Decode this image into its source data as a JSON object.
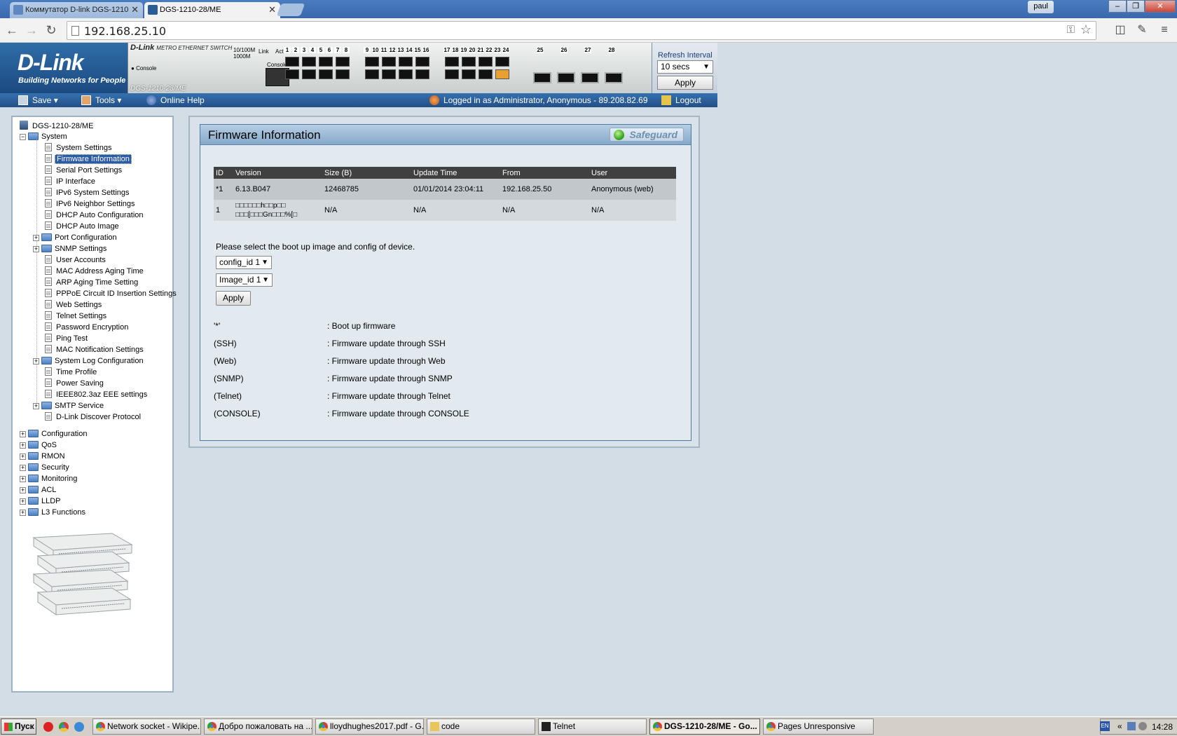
{
  "browser": {
    "tabs": [
      {
        "title": "Коммутатор D-link DGS-1210",
        "active": false
      },
      {
        "title": "DGS-1210-28/ME",
        "active": true
      }
    ],
    "url": "192.168.25.10",
    "user": "paul",
    "window_buttons": [
      "–",
      "❐",
      "✕"
    ]
  },
  "dlink": {
    "brand": "D-Link",
    "tagline": "Building Networks for People",
    "panel_brand": "D-Link",
    "panel_subtitle": "METRO ETHERNET SWITCH",
    "led_legend": [
      "10/100M",
      "1000M",
      "Link",
      "Act"
    ],
    "console_label": "Console",
    "console_led": "Console",
    "model": "DGS-1210-28/ME",
    "ports_copper": [
      "1",
      "2",
      "3",
      "4",
      "5",
      "6",
      "7",
      "8",
      "9",
      "10",
      "11",
      "12",
      "13",
      "14",
      "15",
      "16",
      "17",
      "18",
      "19",
      "20",
      "21",
      "22",
      "23",
      "24"
    ],
    "ports_sfp": [
      "25",
      "26",
      "27",
      "28"
    ],
    "active_port": "24",
    "refresh": {
      "label": "Refresh Interval",
      "value": "10 secs",
      "apply": "Apply"
    },
    "menu": {
      "save": "Save",
      "tools": "Tools",
      "help": "Online Help",
      "login_status": "Logged in as Administrator, Anonymous - 89.208.82.69",
      "logout": "Logout"
    }
  },
  "tree": {
    "root": "DGS-1210-28/ME",
    "system": "System",
    "system_items": [
      "System Settings",
      "Firmware Information",
      "Serial Port Settings",
      "IP Interface",
      "IPv6 System Settings",
      "IPv6 Neighbor Settings",
      "DHCP Auto Configuration",
      "DHCP Auto Image",
      "Port Configuration",
      "SNMP Settings",
      "User Accounts",
      "MAC Address Aging Time",
      "ARP Aging Time Setting",
      "PPPoE Circuit ID Insertion Settings",
      "Web Settings",
      "Telnet Settings",
      "Password Encryption",
      "Ping Test",
      "MAC Notification Settings",
      "System Log Configuration",
      "Time Profile",
      "Power Saving",
      "IEEE802.3az EEE settings",
      "SMTP Service",
      "D-Link Discover Protocol"
    ],
    "selected": "Firmware Information",
    "top_folders": [
      "Configuration",
      "QoS",
      "RMON",
      "Security",
      "Monitoring",
      "ACL",
      "LLDP",
      "L3 Functions"
    ]
  },
  "firmware": {
    "title": "Firmware Information",
    "safeguard": "Safeguard",
    "table": {
      "headers": [
        "ID",
        "Version",
        "Size (B)",
        "Update Time",
        "From",
        "User"
      ],
      "rows": [
        [
          "*1",
          "6.13.B047",
          "12468785",
          "01/01/2014 23:04:11",
          "192.168.25.50",
          "Anonymous (web)"
        ],
        [
          "1",
          "□□□□□□h□□p□□ □□□[□□□Gn□□□%[□",
          "N/A",
          "N/A",
          "N/A",
          "N/A"
        ]
      ]
    },
    "prompt": "Please select the boot up image and config of device.",
    "config_select": "config_id 1",
    "image_select": "Image_id 1",
    "apply": "Apply",
    "legend": [
      {
        "key": "'*'",
        "desc": ": Boot up firmware"
      },
      {
        "key": "(SSH)",
        "desc": ": Firmware update through SSH"
      },
      {
        "key": "(Web)",
        "desc": ": Firmware update through Web"
      },
      {
        "key": "(SNMP)",
        "desc": ": Firmware update through SNMP"
      },
      {
        "key": "(Telnet)",
        "desc": ": Firmware update through Telnet"
      },
      {
        "key": "(CONSOLE)",
        "desc": ": Firmware update through CONSOLE"
      }
    ]
  },
  "taskbar": {
    "start": "Пуск",
    "items": [
      {
        "label": "Network socket - Wikipe...",
        "active": false
      },
      {
        "label": "Добро пожаловать на ...",
        "active": false
      },
      {
        "label": "lloydhughes2017.pdf - G...",
        "active": false
      },
      {
        "label": "code",
        "active": false
      },
      {
        "label": "Telnet",
        "active": false
      },
      {
        "label": "DGS-1210-28/ME - Go...",
        "active": true
      },
      {
        "label": "Pages Unresponsive",
        "active": false
      }
    ],
    "lang": "EN",
    "clock": "14:28"
  }
}
